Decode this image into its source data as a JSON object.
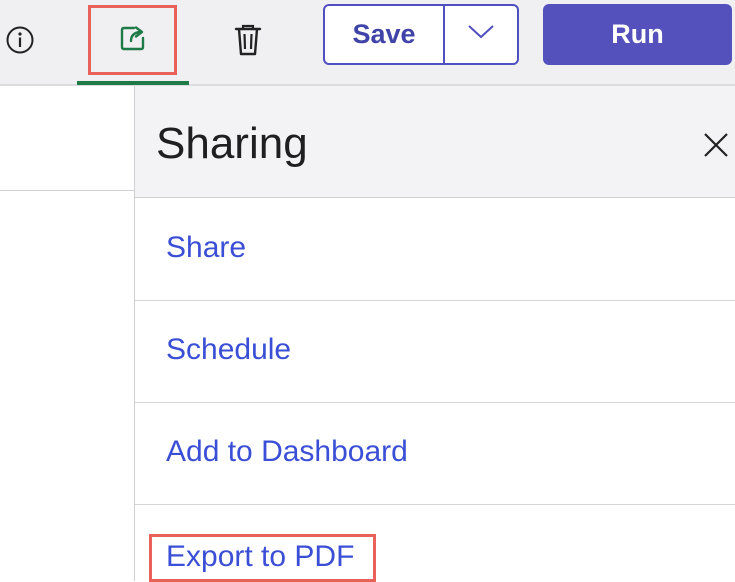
{
  "toolbar": {
    "info_icon": "info-circle-icon",
    "share_icon": "share-export-icon",
    "trash_icon": "trash-icon",
    "save_label": "Save",
    "save_dropdown_icon": "chevron-down-icon",
    "run_label": "Run",
    "colors": {
      "primary": "#5451bd",
      "share_active": "#1e7a46",
      "highlight": "#e8625a"
    }
  },
  "panel": {
    "title": "Sharing",
    "close_icon": "close-icon",
    "items": [
      {
        "label": "Share"
      },
      {
        "label": "Schedule"
      },
      {
        "label": "Add to Dashboard"
      },
      {
        "label": "Export to PDF"
      }
    ],
    "link_color": "#3a4fd6"
  }
}
